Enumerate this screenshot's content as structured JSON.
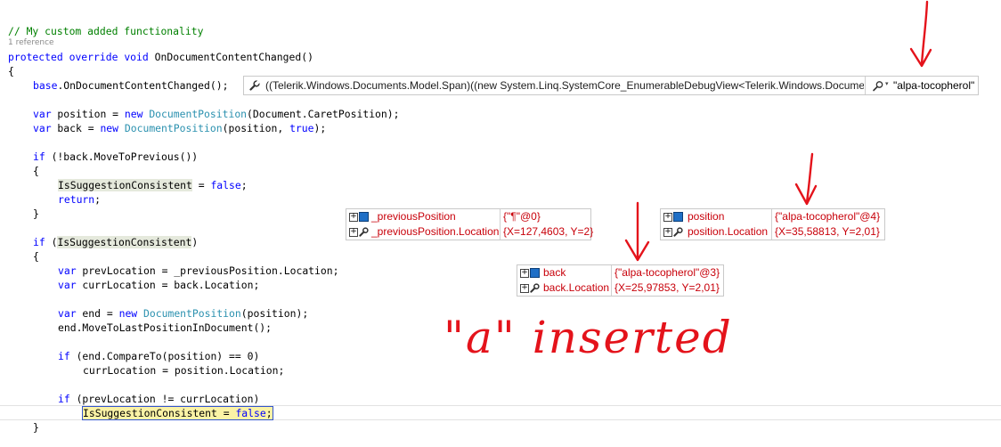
{
  "code": {
    "comment": "// My custom added functionality",
    "reference_count": "1 reference",
    "signature": {
      "kw_protected": "protected",
      "kw_override": "override",
      "kw_void": "void",
      "method": " OnDocumentContentChanged()"
    },
    "lines": {
      "open_brace": "{",
      "base_call_kw": "base",
      "base_call_rest": ".OnDocumentContentChanged();",
      "var1_kw": "var",
      "var1_a": " position = ",
      "var1_new": "new",
      "var1_type": "DocumentPosition",
      "var1_b": "(Document.CaretPosition);",
      "var2_kw": "var",
      "var2_a": " back = ",
      "var2_new": "new",
      "var2_type": "DocumentPosition",
      "var2_b": "(position, ",
      "var2_true": "true",
      "var2_c": ");",
      "if1_kw": "if",
      "if1_rest": " (!back.MoveToPrevious())",
      "brace_open2": "{",
      "assign1_hl": "IsSuggestionConsistent",
      "assign1_rest": " = ",
      "assign1_false": "false",
      "assign1_end": ";",
      "return_kw": "return",
      "return_end": ";",
      "brace_close2": "}",
      "if2_kw": "if",
      "if2_a": " (",
      "if2_hl": "IsSuggestionConsistent",
      "if2_b": ")",
      "brace_open3": "{",
      "prev_kw": "var",
      "prev_rest": " prevLocation = _previousPosition.Location;",
      "curr_kw": "var",
      "curr_rest": " currLocation = back.Location;",
      "end_kw": "var",
      "end_a": " end = ",
      "end_new": "new",
      "end_type": "DocumentPosition",
      "end_b": "(position);",
      "move_last": "end.MoveToLastPositionInDocument();",
      "if3_kw": "if",
      "if3_rest": " (end.CompareTo(position) == 0)",
      "curr_assign": "currLocation = position.Location;",
      "if4_kw": "if",
      "if4_rest": " (prevLocation != currLocation)",
      "assign2_hl": "IsSuggestionConsistent",
      "assign2_rest": " = ",
      "assign2_false": "false",
      "assign2_end": ";",
      "brace_close3": "}"
    }
  },
  "watch_bar": {
    "icon": "wrench-icon",
    "expression": "((Telerik.Windows.Documents.Model.Span)((new System.Linq.SystemCore_EnumerableDebugView<Telerik.Windows.Document",
    "result_icon": "magnifier-icon",
    "result": "\"alpa-tocopherol\""
  },
  "datatips": {
    "previous": [
      {
        "name": "_previousPosition",
        "value": "{\"¶\"@0}",
        "icon": "object-lock-icon"
      },
      {
        "name": "_previousPosition.Location",
        "value": "{X=127,4603, Y=2}",
        "icon": "wrench-icon"
      }
    ],
    "position": [
      {
        "name": "position",
        "value": "{\"alpa-tocopherol\"@4}",
        "icon": "object-icon"
      },
      {
        "name": "position.Location",
        "value": "{X=35,58813, Y=2,01}",
        "icon": "wrench-icon"
      }
    ],
    "back": [
      {
        "name": "back",
        "value": "{\"alpa-tocopherol\"@3}",
        "icon": "object-icon"
      },
      {
        "name": "back.Location",
        "value": "{X=25,97853, Y=2,01}",
        "icon": "wrench-icon"
      }
    ]
  },
  "annotation": "\"a\" inserted",
  "colors": {
    "keyword": "#0000ff",
    "type": "#2b91af",
    "comment": "#008000",
    "datatip_text": "#c8000a",
    "annotation": "#e4131b"
  }
}
